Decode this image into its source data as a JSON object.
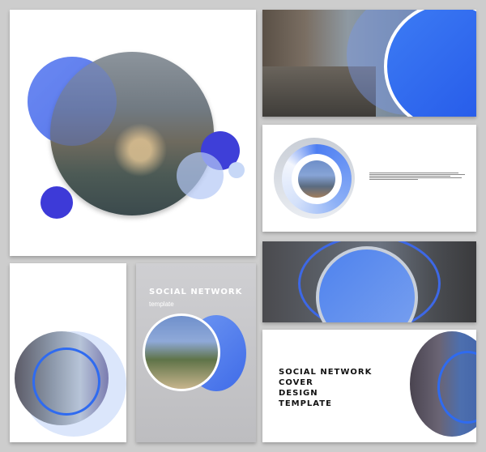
{
  "cards": {
    "vertical_grey": {
      "title": "SOCIAL NETWORK",
      "subtitle": "template"
    },
    "bottom_right": {
      "title_lines": [
        "SOCIAL NETWORK",
        "COVER",
        "DESIGN",
        "TEMPLATE"
      ]
    }
  },
  "colors": {
    "accent_blue": "#2f6bf0",
    "deep_blue": "#3a3ee0",
    "light_blue": "#b9cdf5",
    "background": "#cdcdcd"
  }
}
